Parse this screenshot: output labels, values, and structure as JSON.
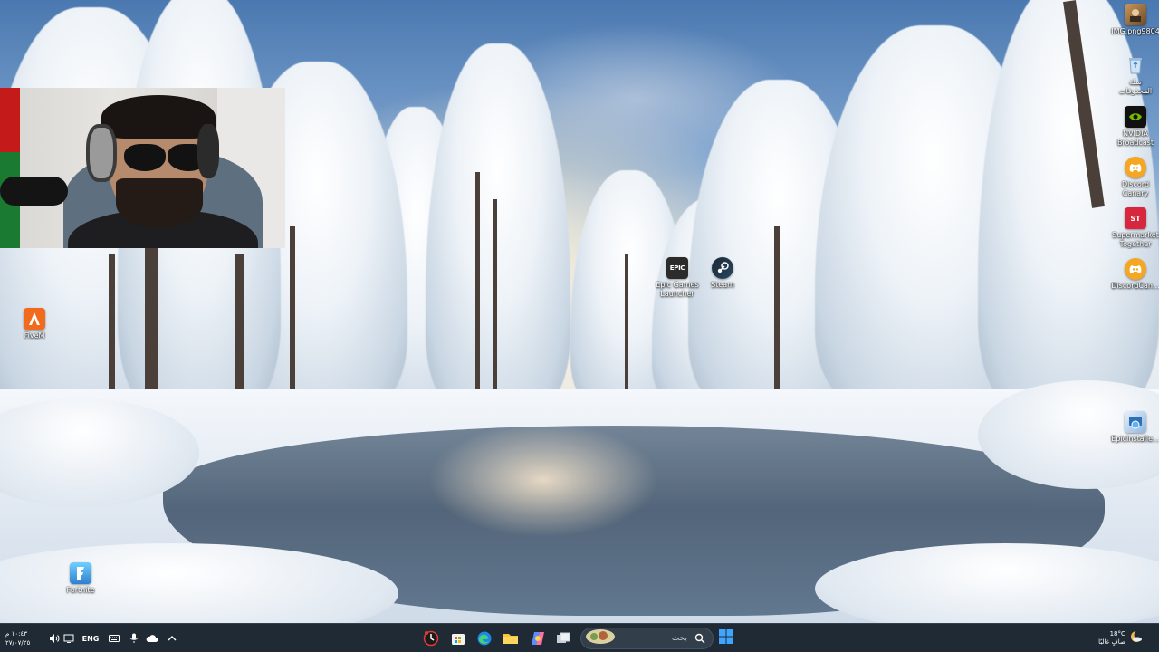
{
  "desktop": {
    "icons_right": [
      {
        "id": "img-file",
        "label": "IMG.png9804"
      },
      {
        "id": "recycle-bin",
        "label": "سلة\nالمحذوفات"
      },
      {
        "id": "nvidia-broadcast",
        "label": "NVIDIA\nBroadcast"
      },
      {
        "id": "discord-canary",
        "label": "Discord\nCanary"
      },
      {
        "id": "supermarket-together",
        "label": "Supermarket\nTogether"
      },
      {
        "id": "discord-canary-2",
        "label": "DiscordCan..."
      },
      {
        "id": "epic-installer",
        "label": "EpicInstalle..."
      }
    ],
    "icons_center": [
      {
        "id": "epic-games",
        "label": "Epic Games\nLauncher",
        "glyph": "EPIC"
      },
      {
        "id": "steam",
        "label": "Steam"
      }
    ],
    "icons_left": [
      {
        "id": "fivem",
        "label": "FiveM"
      },
      {
        "id": "fortnite",
        "label": "Fortnite"
      }
    ]
  },
  "taskbar": {
    "clock": {
      "time": "١٠:٤٣ م",
      "date": "٢٧/٠٧/٢٥"
    },
    "language": "ENG",
    "search": {
      "label": "بحث"
    },
    "weather": {
      "temperature": "18°C",
      "condition": "صافٍ غالبًا"
    },
    "apps": [
      "recording-app",
      "store",
      "edge",
      "file-explorer",
      "copilot",
      "task-view",
      "start"
    ]
  },
  "colors": {
    "taskbar_bg": "#1f2a35",
    "accent_blue": "#0a84ff",
    "epic_dark": "#2b2b2b",
    "fivem_orange": "#f26a1b",
    "discord_yellow": "#f5a623",
    "nvidia_green": "#76b900"
  }
}
